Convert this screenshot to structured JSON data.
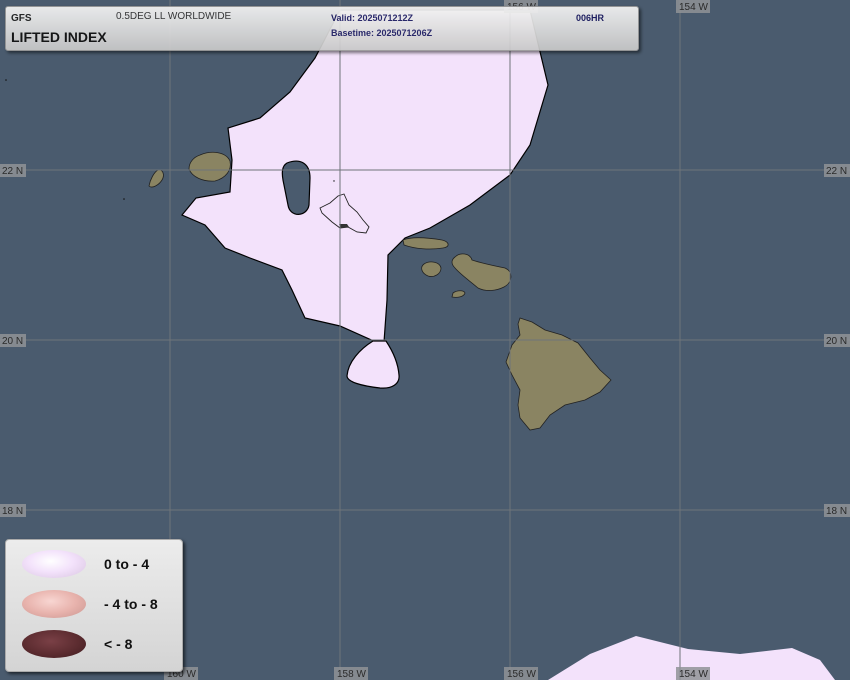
{
  "header": {
    "model": "GFS",
    "grid": "0.5DEG LL WORLDWIDE",
    "title": "LIFTED INDEX",
    "valid": "Valid: 2025071212Z",
    "basetime": "Basetime: 2025071206Z",
    "forecast_hour": "006HR"
  },
  "grid_labels": {
    "lat_22": "22 N",
    "lat_20": "20 N",
    "lat_18": "18 N",
    "lon_160": "160 W",
    "lon_158": "158 W",
    "lon_156": "156 W",
    "lon_154": "154 W"
  },
  "legend": {
    "items": [
      {
        "label": "0 to - 4",
        "color": "#f3e2fb"
      },
      {
        "label": "- 4 to - 8",
        "color": "#e8b3ad"
      },
      {
        "label": "< - 8",
        "color": "#5c2c30"
      }
    ]
  },
  "colors": {
    "ocean": "#4a5b6e",
    "land": "#8a8462",
    "lifted_index_0_to_minus4": "#f3e2fb",
    "grid_line": "#6f747a"
  }
}
